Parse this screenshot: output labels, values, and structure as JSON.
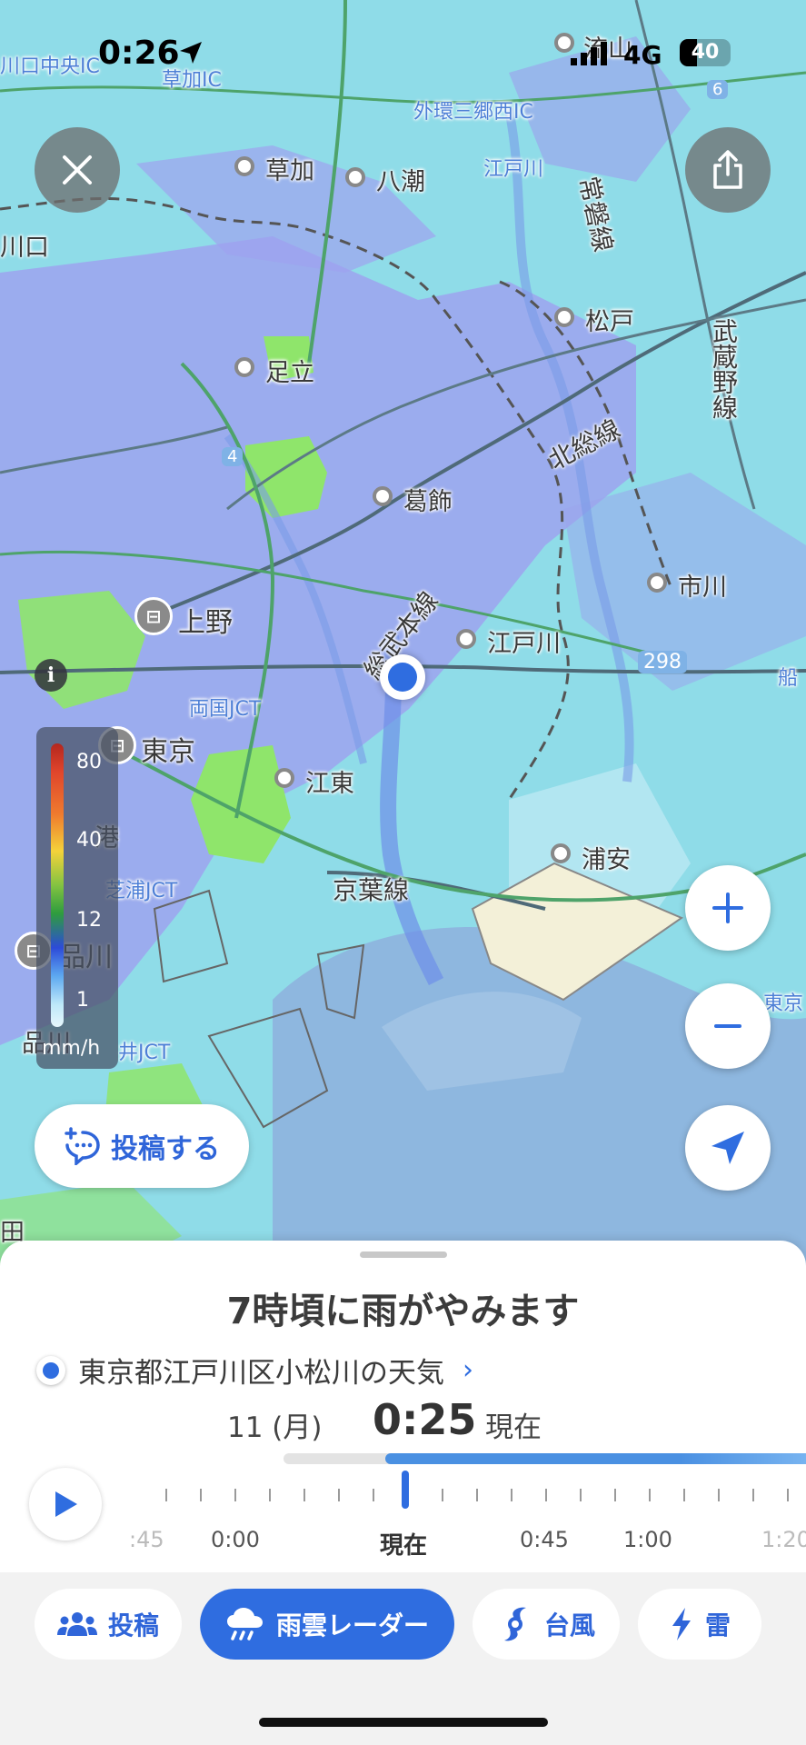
{
  "status_bar": {
    "time": "0:26",
    "network": "4G",
    "battery": "40"
  },
  "map": {
    "labels": {
      "kusaka_ic": "草加IC",
      "kawaguchi_chuo_ic": "川口中央IC",
      "gaikan_misato_nishi_ic": "外環三郷西IC",
      "nagareyama": "流山",
      "soka": "草加",
      "yashio": "八潮",
      "edogawa_river": "江戸川",
      "kawaguchi": "川口",
      "joban_line": "常磐線",
      "matsudo": "松戸",
      "musashino_line": "武蔵野線",
      "adachi": "足立",
      "hokuso_line": "北総線",
      "katsushika": "葛飾",
      "ichikawa": "市川",
      "ueno": "上野",
      "sobu_line": "総武本線",
      "edogawa": "江戸川",
      "ryogoku_jct": "両国JCT",
      "tokyo": "東京",
      "koto": "江東",
      "minato": "港",
      "shibaura_jct": "芝浦JCT",
      "urayasu": "浦安",
      "keiyo_line": "京葉線",
      "shinagawa": "品川",
      "shinagawa2": "品川",
      "oi_jct": "井JCT",
      "tokyo_right": "東京",
      "route_298": "298",
      "route_6": "6",
      "route_4": "4",
      "funabashi": "船",
      "ota": "田"
    }
  },
  "legend": {
    "ticks": [
      "80",
      "40",
      "12",
      "1"
    ],
    "unit": "mm/h",
    "info": "i"
  },
  "post_button": {
    "label": "投稿する"
  },
  "sheet": {
    "headline": "7時頃に雨がやみます",
    "location": "東京都江戸川区小松川の天気",
    "date": "11 (月)",
    "time": "0:25",
    "now_label": "現在",
    "timeline_labels": [
      ":45",
      "0:00",
      "現在",
      "0:45",
      "1:00",
      "1:20"
    ]
  },
  "tabs": [
    {
      "label": "投稿",
      "icon": "people-icon"
    },
    {
      "label": "雨雲レーダー",
      "icon": "rain-cloud-icon"
    },
    {
      "label": "台風",
      "icon": "typhoon-icon"
    },
    {
      "label": "雷",
      "icon": "lightning-icon"
    }
  ],
  "colors": {
    "accent": "#2f6de0",
    "rain_light": "#8fdcea",
    "rain_mid": "#8f9ff0",
    "rain_heavy": "#8fe36a",
    "sea": "#8eb7df"
  }
}
